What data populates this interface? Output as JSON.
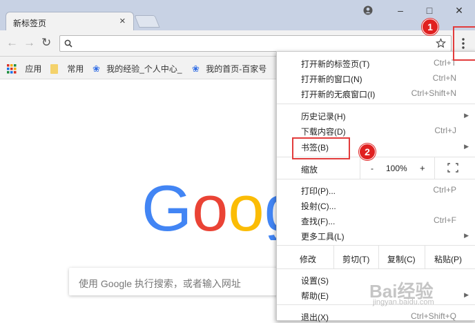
{
  "tab": {
    "title": "新标签页",
    "close": "×"
  },
  "window": {
    "minimize": "–",
    "maximize": "□",
    "close": "✕"
  },
  "toolbar": {
    "back": "←",
    "forward": "→",
    "reload": "↻",
    "address_value": ""
  },
  "bookmarks": [
    {
      "label": "应用",
      "icon": "apps-grid-icon"
    },
    {
      "label": "常用",
      "icon": "folder-icon"
    },
    {
      "label": "我的经验_个人中心_",
      "icon": "baidu-paw-icon"
    },
    {
      "label": "我的首页-百家号",
      "icon": "baidu-paw-icon"
    }
  ],
  "search": {
    "placeholder": "使用 Google 执行搜索，或者输入网址"
  },
  "menu": {
    "new_tab": "打开新的标签页(T)",
    "new_tab_sc": "Ctrl+T",
    "new_window": "打开新的窗口(N)",
    "new_window_sc": "Ctrl+N",
    "incognito": "打开新的无痕窗口(I)",
    "incognito_sc": "Ctrl+Shift+N",
    "history": "历史记录(H)",
    "downloads": "下载内容(D)",
    "downloads_sc": "Ctrl+J",
    "bookmarks": "书签(B)",
    "zoom": "缩放",
    "zoom_minus": "-",
    "zoom_value": "100%",
    "zoom_plus": "+",
    "print": "打印(P)...",
    "print_sc": "Ctrl+P",
    "cast": "投射(C)...",
    "find": "查找(F)...",
    "find_sc": "Ctrl+F",
    "more_tools": "更多工具(L)",
    "edit": "修改",
    "cut": "剪切(T)",
    "copy": "复制(C)",
    "paste": "粘贴(P)",
    "settings": "设置(S)",
    "help": "帮助(E)",
    "exit": "退出(X)",
    "exit_sc": "Ctrl+Shift+Q"
  },
  "annotations": {
    "step1": "1",
    "step2": "2"
  },
  "watermark": {
    "text": "Bai经验",
    "sub": "jingyan.baidu.com"
  },
  "logo": {
    "text": "Google"
  },
  "colors": {
    "titlebar": "#c8d2e4",
    "annotation_red": "#e23b3b"
  }
}
